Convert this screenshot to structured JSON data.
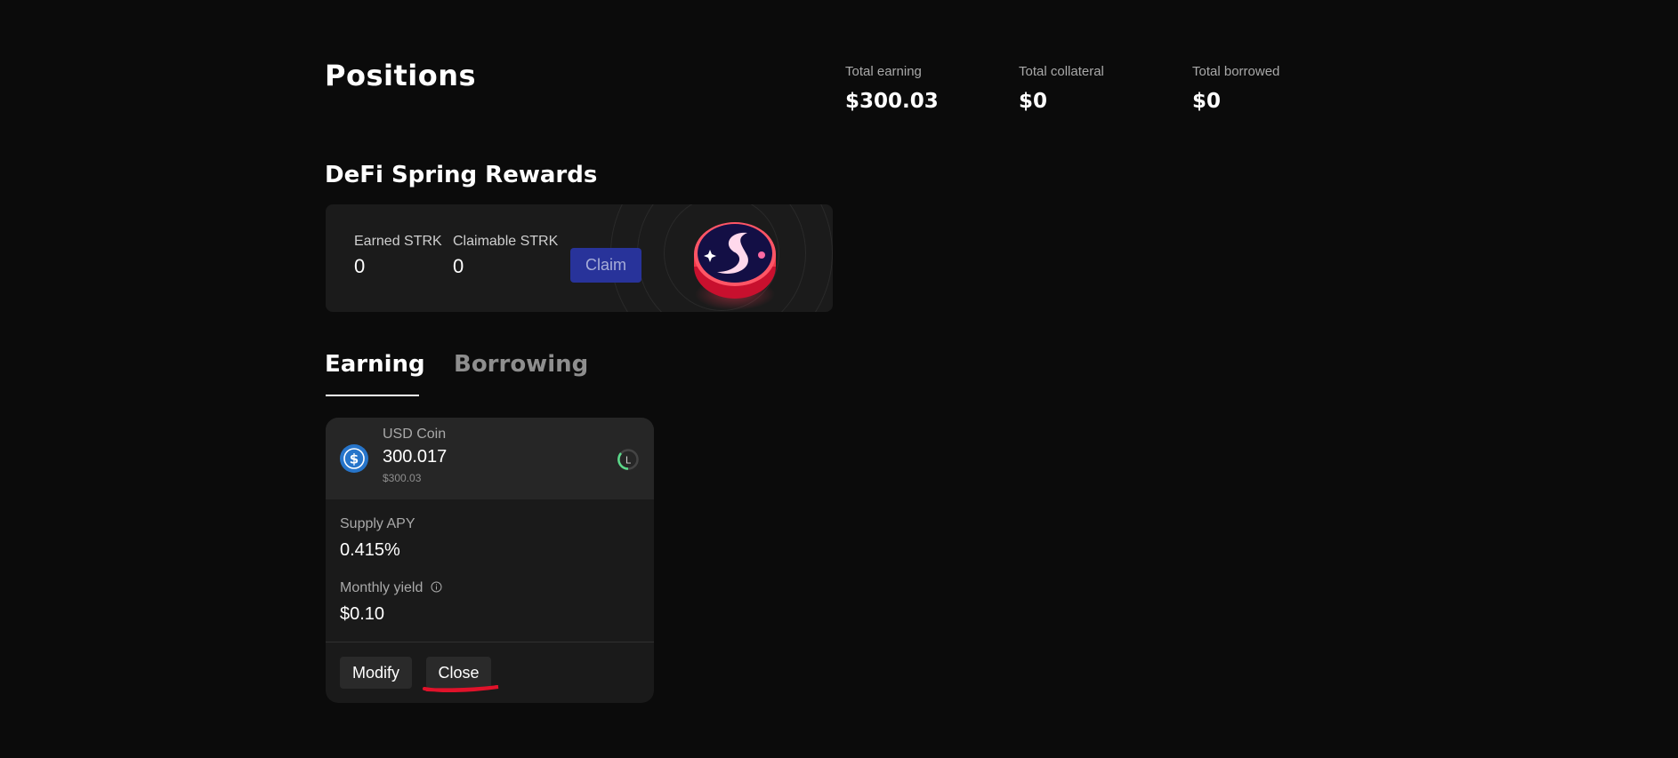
{
  "page": {
    "title": "Positions"
  },
  "stats": {
    "total_earning_label": "Total earning",
    "total_earning_value": "$300.03",
    "total_collateral_label": "Total collateral",
    "total_collateral_value": "$0",
    "total_borrowed_label": "Total borrowed",
    "total_borrowed_value": "$0"
  },
  "rewards": {
    "title": "DeFi Spring Rewards",
    "earned_label": "Earned STRK",
    "earned_value": "0",
    "claimable_label": "Claimable STRK",
    "claimable_value": "0",
    "claim_label": "Claim",
    "logo_icon": "strk-coin-icon"
  },
  "tabs": [
    {
      "label": "Earning",
      "active": true
    },
    {
      "label": "Borrowing",
      "active": false
    }
  ],
  "position": {
    "asset_name": "USD Coin",
    "amount": "300.017",
    "usd_value": "$300.03",
    "asset_icon": "usdc-icon",
    "loop_icon": "loop-status-icon",
    "supply_apy_label": "Supply APY",
    "supply_apy_value": "0.415%",
    "monthly_yield_label": "Monthly yield",
    "monthly_yield_value": "$0.10",
    "info_icon": "info-icon",
    "modify_label": "Modify",
    "close_label": "Close"
  },
  "colors": {
    "background": "#0b0b0b",
    "card": "#1b1b1b",
    "claim_button": "#28339a",
    "usdc_blue": "#2775ca",
    "annotation_red": "#e0122a"
  }
}
